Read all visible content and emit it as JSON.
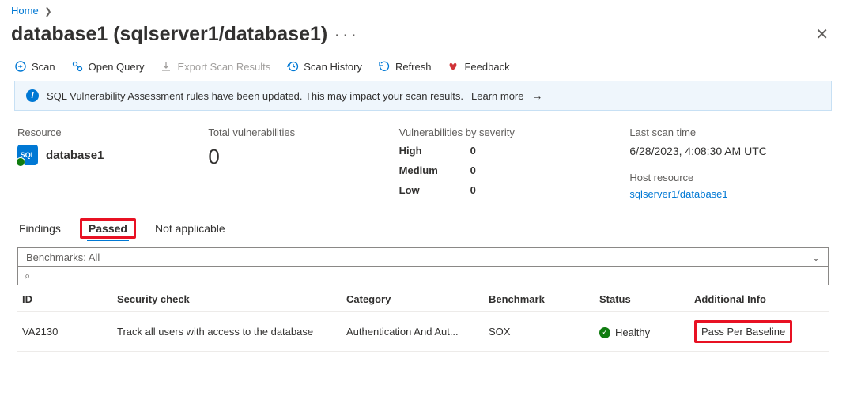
{
  "breadcrumb": {
    "home": "Home"
  },
  "header": {
    "title": "database1 (sqlserver1/database1)"
  },
  "toolbar": {
    "scan": "Scan",
    "open_query": "Open Query",
    "export": "Export Scan Results",
    "history": "Scan History",
    "refresh": "Refresh",
    "feedback": "Feedback"
  },
  "banner": {
    "text": "SQL Vulnerability Assessment rules have been updated. This may impact your scan results.",
    "learn_more": "Learn more"
  },
  "summary": {
    "resource_label": "Resource",
    "resource_name": "database1",
    "total_label": "Total vulnerabilities",
    "total_value": "0",
    "severity_label": "Vulnerabilities by severity",
    "severity": {
      "high_k": "High",
      "high_v": "0",
      "med_k": "Medium",
      "med_v": "0",
      "low_k": "Low",
      "low_v": "0"
    },
    "last_scan_label": "Last scan time",
    "last_scan_value": "6/28/2023, 4:08:30 AM UTC",
    "host_label": "Host resource",
    "host_value": "sqlserver1/database1"
  },
  "tabs": {
    "findings": "Findings",
    "passed": "Passed",
    "na": "Not applicable"
  },
  "filter": {
    "benchmarks": "Benchmarks: All",
    "search_glyph": "⌕"
  },
  "table": {
    "headers": {
      "id": "ID",
      "check": "Security check",
      "category": "Category",
      "benchmark": "Benchmark",
      "status": "Status",
      "addl": "Additional Info"
    },
    "rows": [
      {
        "id": "VA2130",
        "check": "Track all users with access to the database",
        "category": "Authentication And Aut...",
        "benchmark": "SOX",
        "status": "Healthy",
        "addl": "Pass Per Baseline"
      }
    ]
  }
}
